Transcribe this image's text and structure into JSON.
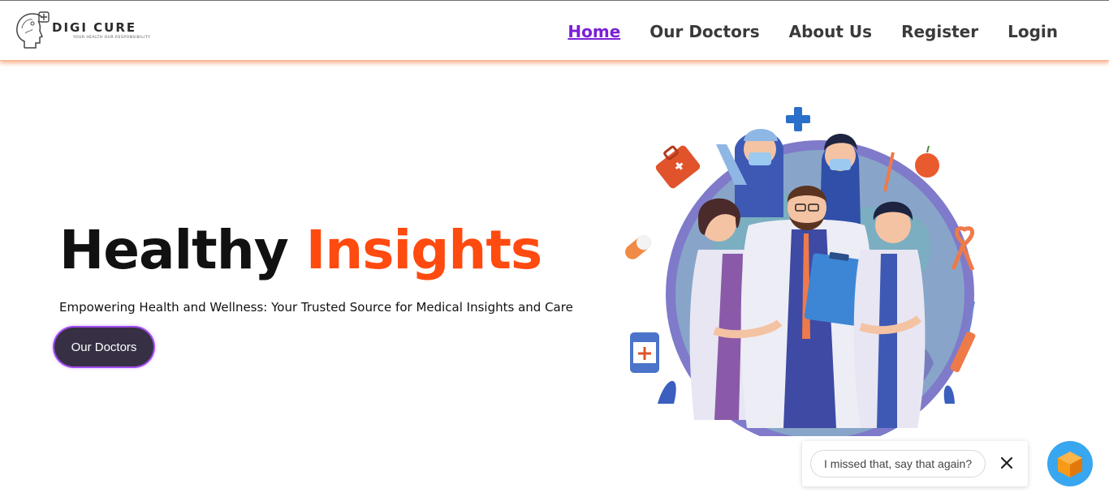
{
  "brand": {
    "name": "DIGI CURE",
    "tagline": "YOUR HEALTH OUR RESPONSIBILITY"
  },
  "nav": {
    "items": [
      {
        "label": "Home",
        "active": true
      },
      {
        "label": "Our Doctors",
        "active": false
      },
      {
        "label": "About Us",
        "active": false
      },
      {
        "label": "Register",
        "active": false
      },
      {
        "label": "Login",
        "active": false
      }
    ]
  },
  "hero": {
    "title_main": "Healthy",
    "title_accent": "Insights",
    "subtitle": "Empowering Health and Wellness: Your Trusted Source for Medical Insights and Care",
    "cta_label": "Our Doctors"
  },
  "chat": {
    "message": "I missed that, say that again?"
  },
  "colors": {
    "accent": "#ff4a10",
    "nav_active": "#7b1ed6",
    "button_bg": "#373045",
    "button_glow": "#a24df2",
    "launcher": "#38a7f0"
  },
  "icons": {
    "logo": "head-plus-icon",
    "close": "close-icon",
    "launcher": "cube-icon"
  }
}
